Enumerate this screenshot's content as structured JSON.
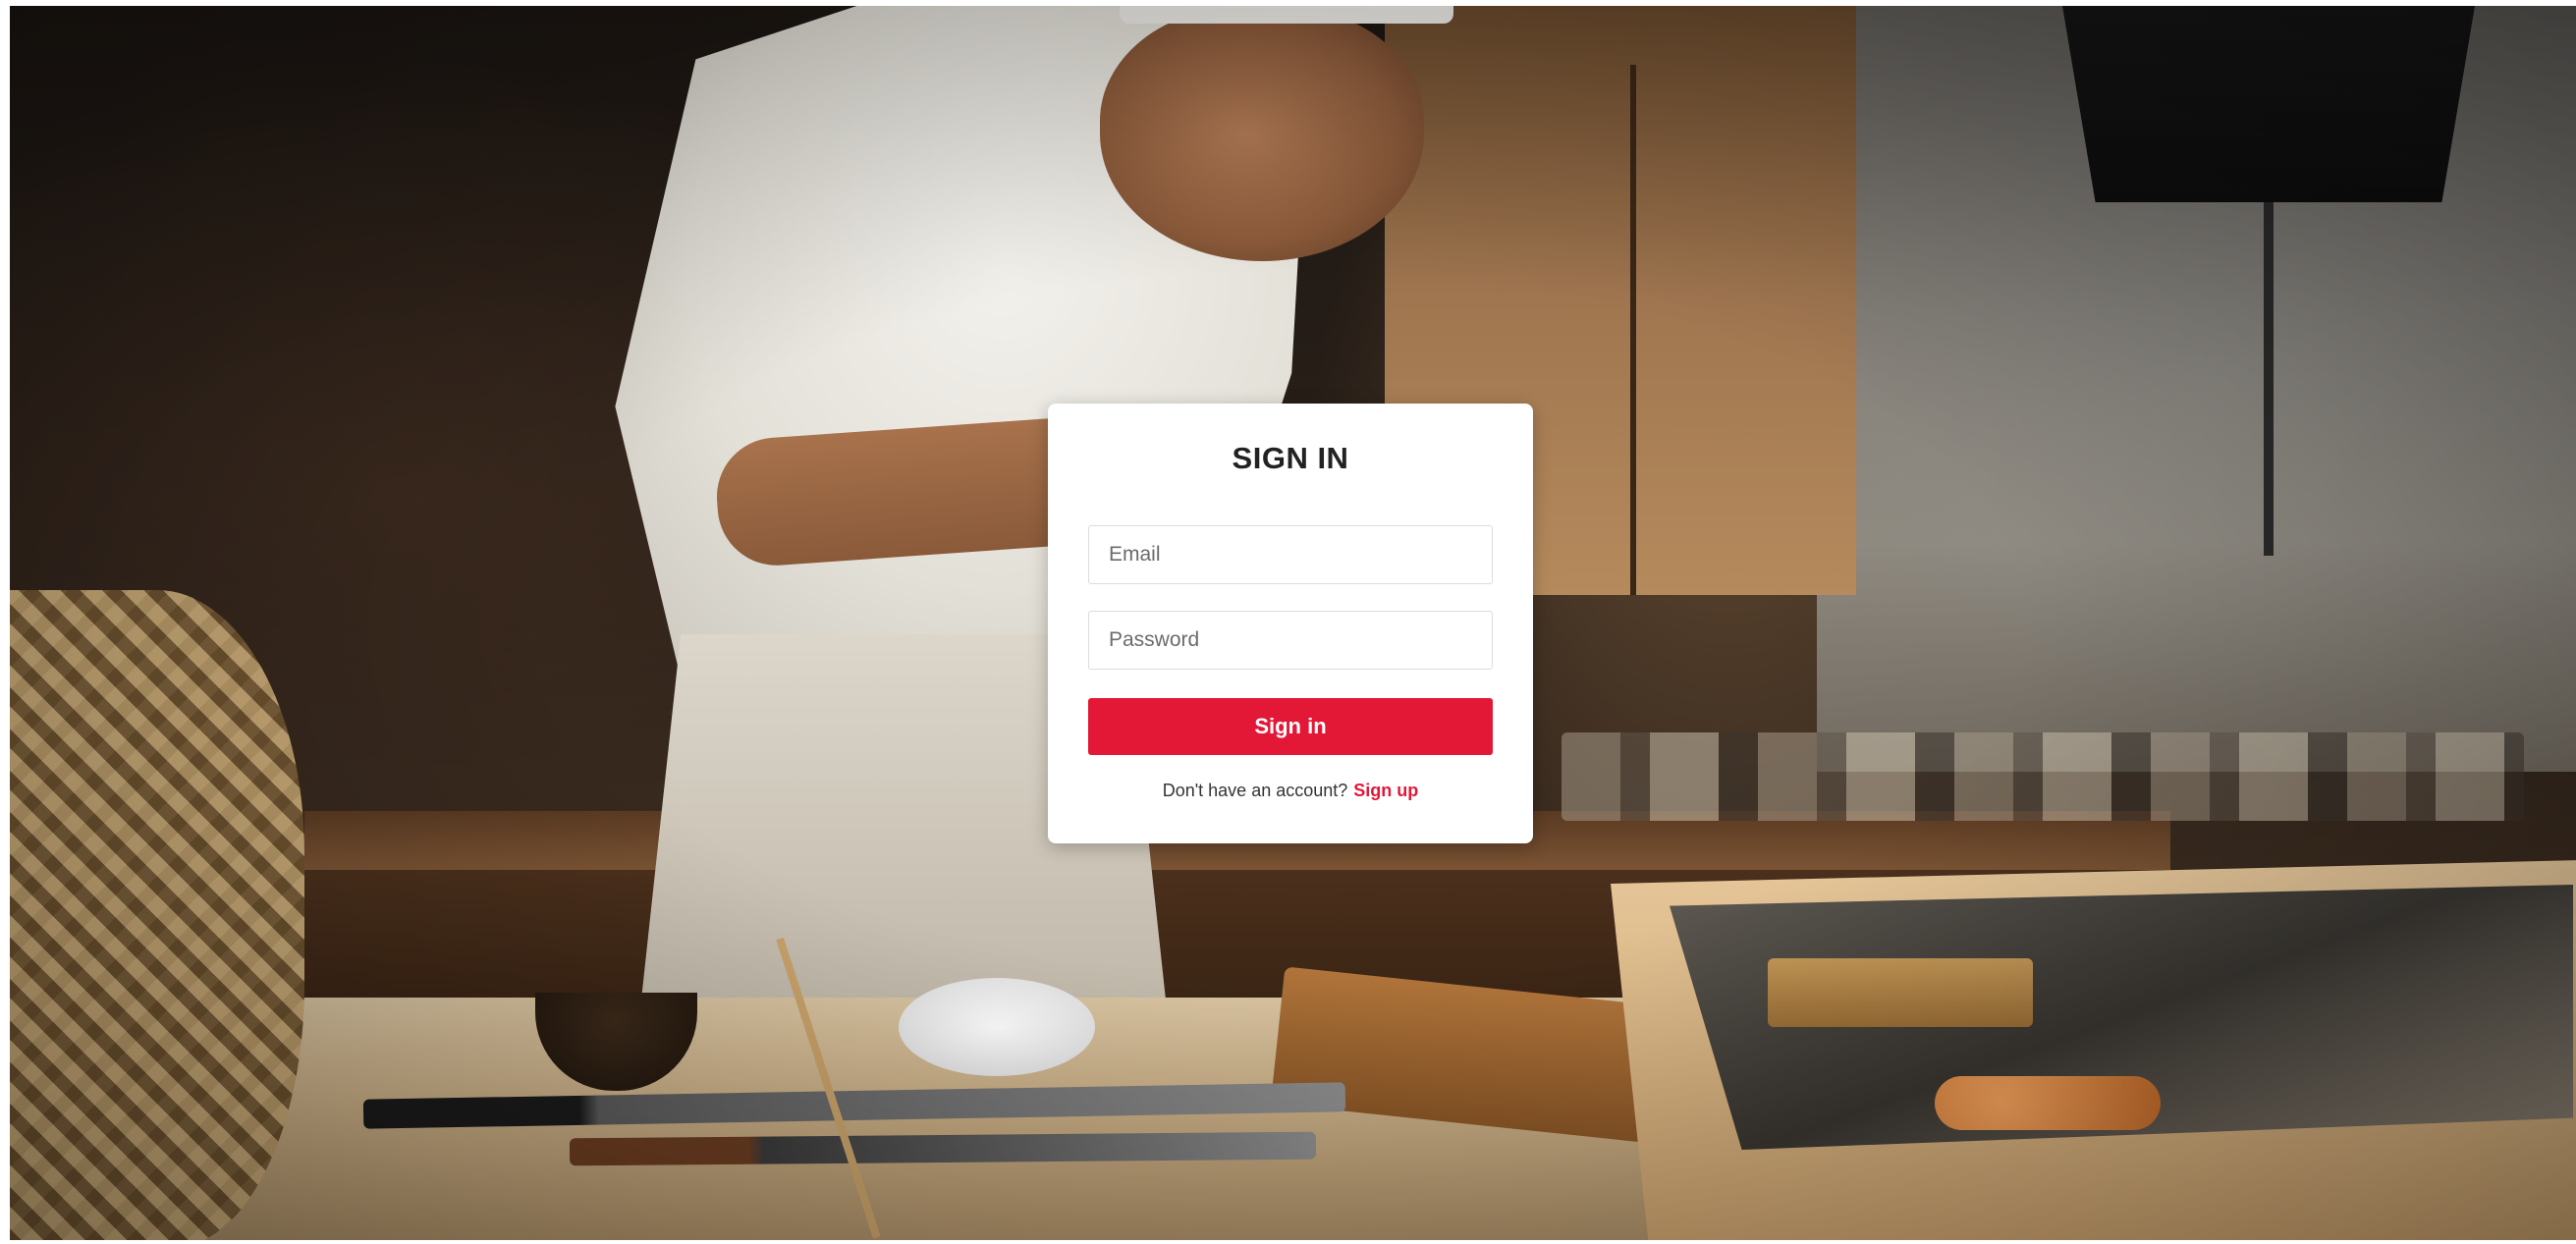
{
  "signin": {
    "title": "SIGN IN",
    "email": {
      "placeholder": "Email",
      "value": ""
    },
    "password": {
      "placeholder": "Password",
      "value": ""
    },
    "submit_label": "Sign in",
    "signup_prompt": "Don't have an account?",
    "signup_link": "Sign up"
  },
  "colors": {
    "accent": "#e31837",
    "card_background": "#ffffff",
    "title_text": "#222222"
  }
}
